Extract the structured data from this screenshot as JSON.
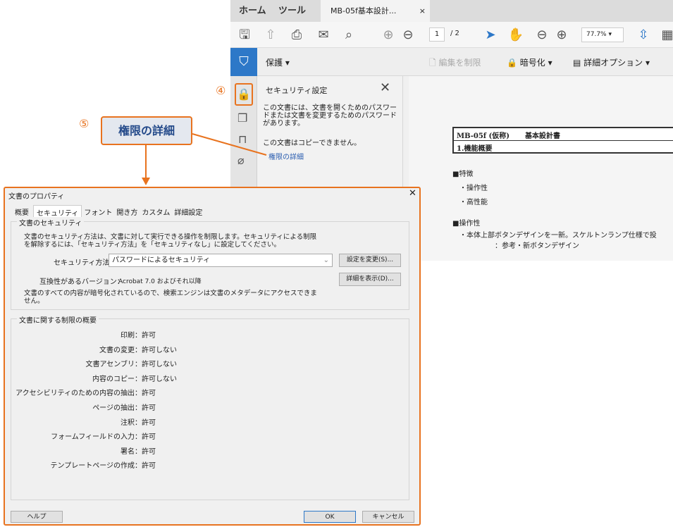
{
  "app": {
    "tabs": {
      "home": "ホーム",
      "tools": "ツール",
      "document": "MB-05f基本設計...",
      "close": "×"
    },
    "toolbar": {
      "page_current": "1",
      "page_total": "/ 2",
      "zoom": "77.7%"
    },
    "protect_bar": {
      "protect": "保護 ▾",
      "restrict_edit": "編集を制限",
      "encrypt": "暗号化 ▾",
      "advanced": "詳細オプション ▾"
    },
    "security_panel": {
      "title": "セキュリティ設定",
      "message": "この文書には、文書を開くためのパスワードまたは文書を変更するためのパスワードがあります。",
      "copy_note": "この文書はコピーできません。",
      "link": "権限の詳細"
    },
    "document": {
      "header_title": "MB-05f (仮称)",
      "header_subtitle": "基本設計書",
      "section": "1.機能概要",
      "feature_heading": "■特徴",
      "features": [
        "・操作性",
        "・高性能"
      ],
      "usability_heading": "■操作性",
      "usability_line": "・本体上部ボタンデザインを一新。スケルトンランプ仕様で投",
      "reference": "：参考・新ボタンデザイン"
    }
  },
  "callouts": {
    "step4": "④",
    "step5": "⑤",
    "step5_label": "権限の詳細"
  },
  "dialog": {
    "title": "文書のプロパティ",
    "close": "✕",
    "tabs": [
      "概要",
      "セキュリティ",
      "フォント",
      "開き方",
      "カスタム",
      "詳細設定"
    ],
    "security_group": {
      "title": "文書のセキュリティ",
      "description": "文書のセキュリティ方法は、文書に対して実行できる操作を制限します。セキュリティによる制限を解除するには、「セキュリティ方法」を「セキュリティなし」に設定してください。",
      "method_label": "セキュリティ方法(M)：",
      "method_value": "パスワードによるセキュリティ",
      "change_button": "設定を変更(S)...",
      "compat_label": "互換性があるバージョン：",
      "compat_value": "Acrobat 7.0 およびそれ以降",
      "details_button": "詳細を表示(D)...",
      "encrypt_note": "文書のすべての内容が暗号化されているので、検索エンジンは文書のメタデータにアクセスできません。"
    },
    "restrictions_group": {
      "title": "文書に関する制限の概要",
      "rows": [
        {
          "label": "印刷：",
          "value": "許可"
        },
        {
          "label": "文書の変更：",
          "value": "許可しない"
        },
        {
          "label": "文書アセンブリ：",
          "value": "許可しない"
        },
        {
          "label": "内容のコピー：",
          "value": "許可しない"
        },
        {
          "label": "アクセシビリティのための内容の抽出：",
          "value": "許可"
        },
        {
          "label": "ページの抽出：",
          "value": "許可"
        },
        {
          "label": "注釈：",
          "value": "許可"
        },
        {
          "label": "フォームフィールドの入力：",
          "value": "許可"
        },
        {
          "label": "署名：",
          "value": "許可"
        },
        {
          "label": "テンプレートページの作成：",
          "value": "許可"
        }
      ]
    },
    "buttons": {
      "help": "ヘルプ",
      "ok": "OK",
      "cancel": "キャンセル"
    }
  },
  "colors": {
    "accent": "#e8731f",
    "blue": "#2d78c8",
    "link": "#2a5db0"
  }
}
